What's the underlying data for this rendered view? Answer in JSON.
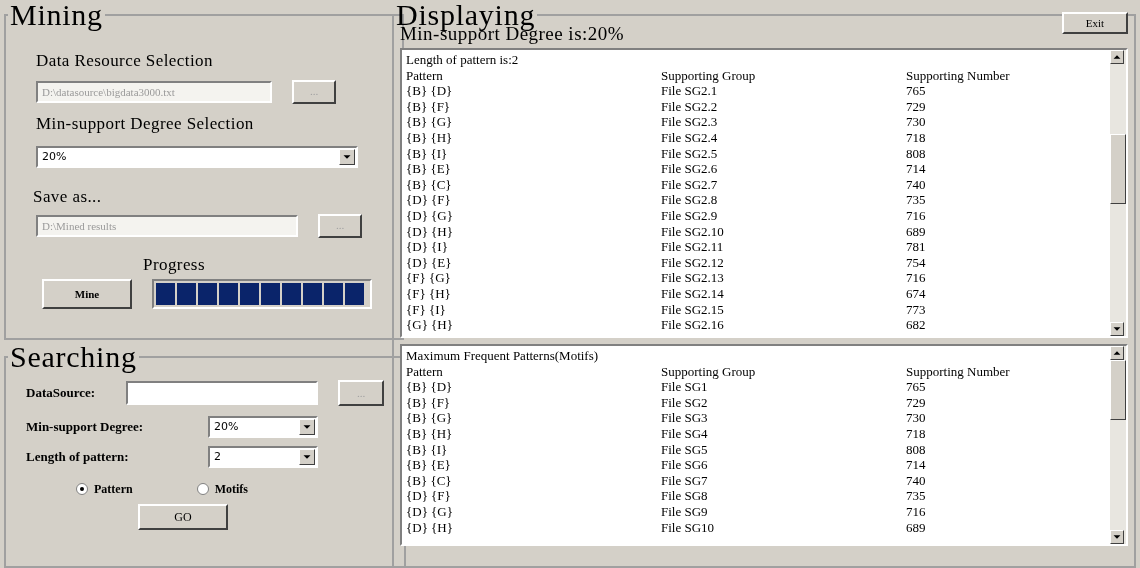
{
  "mining": {
    "title": "Mining",
    "data_label": "Data Resource Selection",
    "data_value": "D:\\datasource\\bigdata3000.txt",
    "data_browse": "...",
    "support_label": "Min-support Degree Selection",
    "support_value": "20%",
    "save_label": "Save as...",
    "save_value": "D:\\Mined results",
    "save_browse": "...",
    "progress_label": "Progress",
    "mine_button": "Mine"
  },
  "searching": {
    "title": "Searching",
    "datasource_label": "DataSource:",
    "datasource_browse": "...",
    "support_label": "Min-support Degree:",
    "support_value": "20%",
    "length_label": "Length of pattern:",
    "length_value": "2",
    "options": [
      {
        "label": "Pattern",
        "selected": true
      },
      {
        "label": "Motifs",
        "selected": false
      }
    ],
    "go_button": "GO"
  },
  "displaying": {
    "title": "Displaying",
    "exit_button": "Exit",
    "subtitle": "Min-support Degree is:20%",
    "lists": [
      {
        "heading": "Length of pattern is:2",
        "columns": [
          "Pattern",
          "Supporting Group",
          "Supporting Number"
        ],
        "rows": [
          [
            "{B} {D}",
            "File SG2.1",
            "765"
          ],
          [
            "{B} {F}",
            "File SG2.2",
            "729"
          ],
          [
            "{B} {G}",
            "File SG2.3",
            "730"
          ],
          [
            "{B} {H}",
            "File SG2.4",
            "718"
          ],
          [
            "{B} {I}",
            "File SG2.5",
            "808"
          ],
          [
            "{B} {E}",
            "File SG2.6",
            "714"
          ],
          [
            "{B} {C}",
            "File SG2.7",
            "740"
          ],
          [
            "{D} {F}",
            "File SG2.8",
            "735"
          ],
          [
            "{D} {G}",
            "File SG2.9",
            "716"
          ],
          [
            "{D} {H}",
            "File SG2.10",
            "689"
          ],
          [
            "{D} {I}",
            "File SG2.11",
            "781"
          ],
          [
            "{D} {E}",
            "File SG2.12",
            "754"
          ],
          [
            "{F} {G}",
            "File SG2.13",
            "716"
          ],
          [
            "{F} {H}",
            "File SG2.14",
            "674"
          ],
          [
            "{F} {I}",
            "File SG2.15",
            "773"
          ],
          [
            "{G} {H}",
            "File SG2.16",
            "682"
          ]
        ]
      },
      {
        "heading": "Maximum Frequent Patterns(Motifs)",
        "columns": [
          "Pattern",
          "Supporting Group",
          "Supporting Number"
        ],
        "rows": [
          [
            "{B} {D}",
            "File SG1",
            "765"
          ],
          [
            "{B} {F}",
            "File SG2",
            "729"
          ],
          [
            "{B} {G}",
            "File SG3",
            "730"
          ],
          [
            "{B} {H}",
            "File SG4",
            "718"
          ],
          [
            "{B} {I}",
            "File SG5",
            "808"
          ],
          [
            "{B} {E}",
            "File SG6",
            "714"
          ],
          [
            "{B} {C}",
            "File SG7",
            "740"
          ],
          [
            "{D} {F}",
            "File SG8",
            "735"
          ],
          [
            "{D} {G}",
            "File SG9",
            "716"
          ],
          [
            "{D} {H}",
            "File SG10",
            "689"
          ]
        ]
      }
    ]
  }
}
